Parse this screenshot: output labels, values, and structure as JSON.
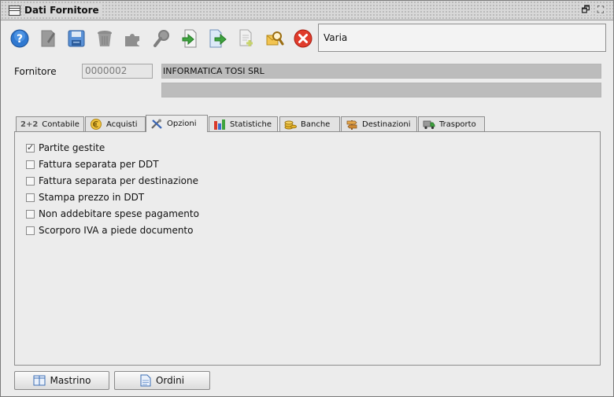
{
  "window": {
    "title": "Dati Fornitore",
    "minimize_label": "🗗",
    "maximize_label": "⛶"
  },
  "toolbar": {
    "buttons": [
      {
        "name": "help-icon"
      },
      {
        "name": "edit-icon"
      },
      {
        "name": "save-icon"
      },
      {
        "name": "delete-icon"
      },
      {
        "name": "puzzle-icon"
      },
      {
        "name": "search-icon"
      },
      {
        "name": "import-icon"
      },
      {
        "name": "export-icon"
      },
      {
        "name": "new-document-icon"
      },
      {
        "name": "find-user-icon"
      },
      {
        "name": "close-icon"
      }
    ],
    "mode_label": "Varia"
  },
  "form": {
    "fornitore_label": "Fornitore",
    "code_value": "0000002",
    "name_value": "INFORMATICA TOSI SRL",
    "name2_value": ""
  },
  "tabs": [
    {
      "label": "Contabile",
      "icon_text": "2+2"
    },
    {
      "label": "Acquisti"
    },
    {
      "label": "Opzioni",
      "active": true
    },
    {
      "label": "Statistiche"
    },
    {
      "label": "Banche"
    },
    {
      "label": "Destinazioni"
    },
    {
      "label": "Trasporto"
    }
  ],
  "options": [
    {
      "label": "Partite gestite",
      "checked": true
    },
    {
      "label": "Fattura separata per DDT",
      "checked": false
    },
    {
      "label": "Fattura separata per destinazione",
      "checked": false
    },
    {
      "label": "Stampa prezzo in DDT",
      "checked": false
    },
    {
      "label": "Non addebitare spese pagamento",
      "checked": false
    },
    {
      "label": "Scorporo IVA a piede documento",
      "checked": false
    }
  ],
  "bottom_buttons": {
    "mastrino": "Mastrino",
    "ordini": "Ordini"
  }
}
